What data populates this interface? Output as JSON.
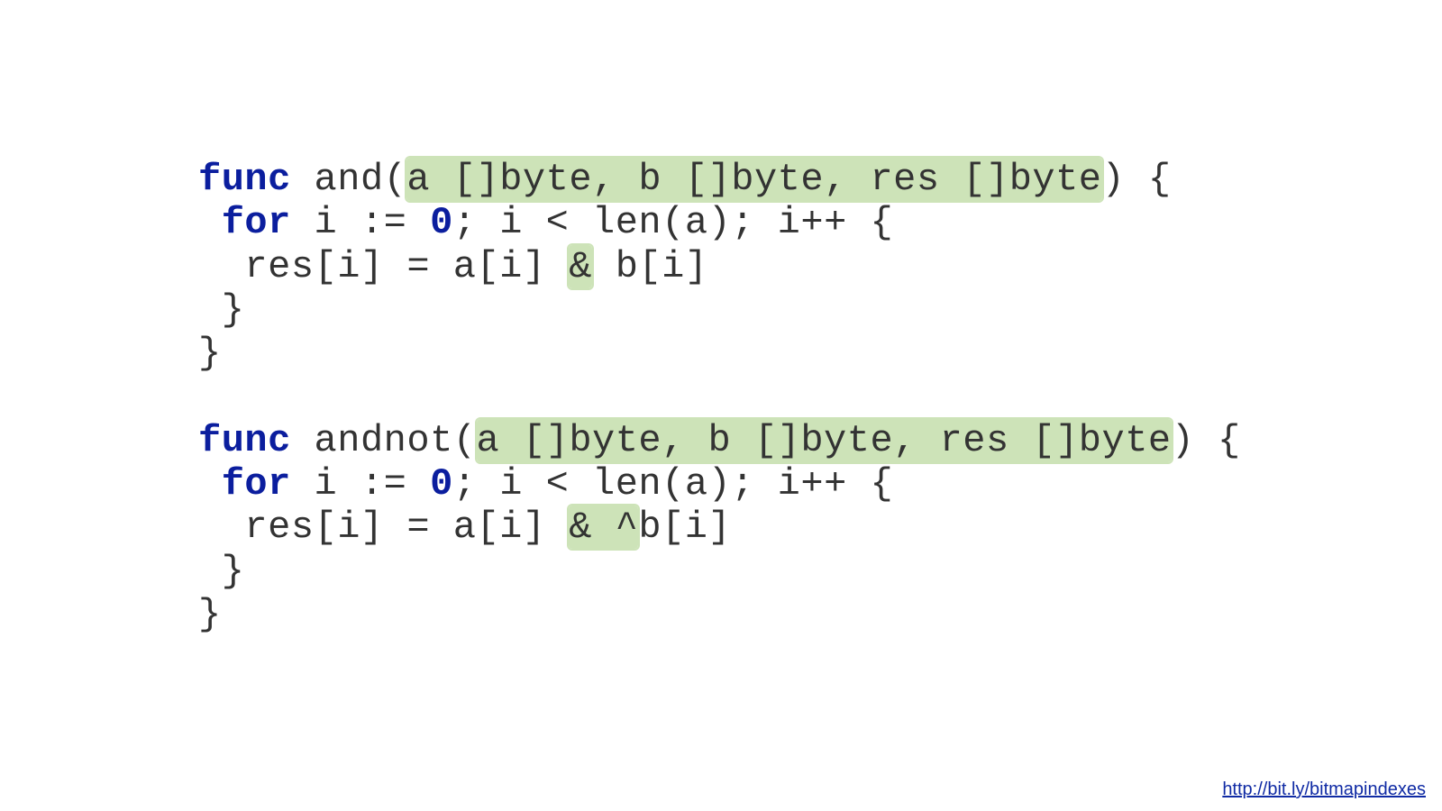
{
  "func1": {
    "kw_func": "func",
    "name": "and",
    "open_paren": "(",
    "params": "a []byte, b []byte, res []byte",
    "after_params": ") {",
    "for_kw": "for",
    "for_rest_1": " i := ",
    "for_zero": "0",
    "for_rest_2": "; i < len(a); i++ {",
    "body_1": "  res[i] = a[i] ",
    "op": "&",
    "body_2": " b[i]",
    "close_inner": " }",
    "close_outer": "}"
  },
  "func2": {
    "kw_func": "func",
    "name": "andnot",
    "open_paren": "(",
    "params": "a []byte, b []byte, res []byte",
    "after_params": ") {",
    "for_kw": "for",
    "for_rest_1": " i := ",
    "for_zero": "0",
    "for_rest_2": "; i < len(a); i++ {",
    "body_1": "  res[i] = a[i] ",
    "op": "& ^",
    "body_2": "b[i]",
    "close_inner": " }",
    "close_outer": "}"
  },
  "footer": {
    "link_text": "http://bit.ly/bitmapindexes",
    "link_href": "http://bit.ly/bitmapindexes"
  }
}
